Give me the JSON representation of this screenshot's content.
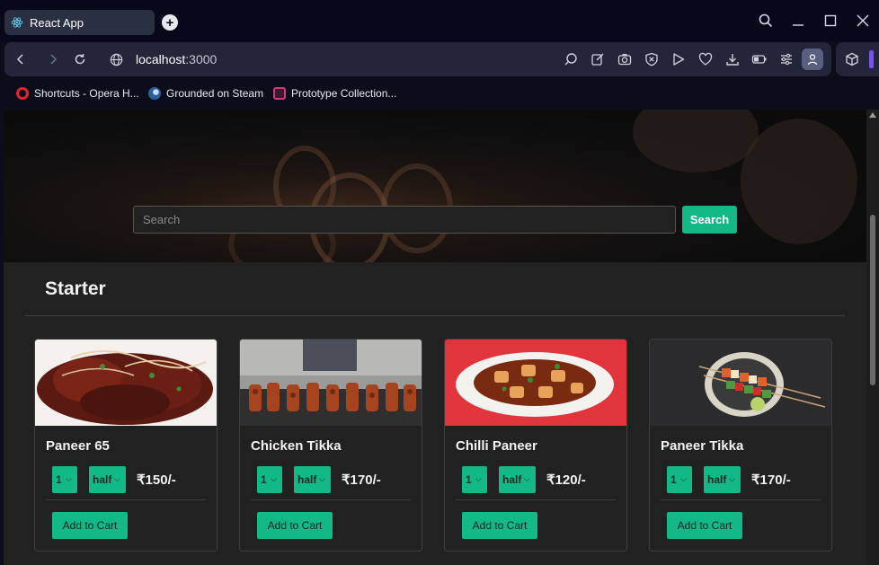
{
  "browser": {
    "tab_title": "React App",
    "url_host": "localhost",
    "url_port": ":3000",
    "bookmarks": [
      {
        "label": "Shortcuts - Opera H...",
        "icon": "opera-icon",
        "color": "#e0262b"
      },
      {
        "label": "Grounded on Steam",
        "icon": "steam-icon",
        "color": "#5b8fd1"
      },
      {
        "label": "Prototype Collection...",
        "icon": "prototype-icon",
        "color": "#d03a7c"
      }
    ]
  },
  "hero": {
    "search_placeholder": "Search",
    "search_value": "",
    "search_button": "Search"
  },
  "menu": {
    "category": "Starter",
    "accent_color": "#12b886",
    "items": [
      {
        "name": "Paneer 65",
        "qty": "1",
        "size": "half",
        "price": "₹150/-",
        "add_label": "Add to Cart"
      },
      {
        "name": "Chicken Tikka",
        "qty": "1",
        "size": "half",
        "price": "₹170/-",
        "add_label": "Add to Cart"
      },
      {
        "name": "Chilli Paneer",
        "qty": "1",
        "size": "half",
        "price": "₹120/-",
        "add_label": "Add to Cart"
      },
      {
        "name": "Paneer Tikka",
        "qty": "1",
        "size": "half",
        "price": "₹170/-",
        "add_label": "Add to Cart"
      }
    ]
  }
}
